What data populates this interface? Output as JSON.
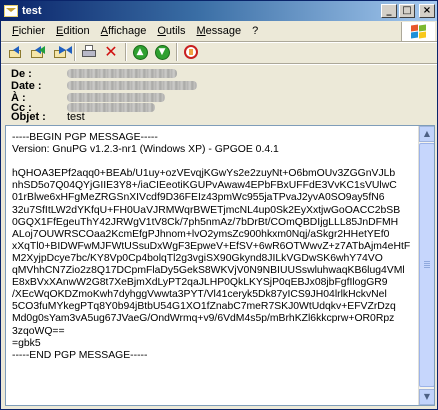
{
  "window": {
    "title": "test"
  },
  "menubar": {
    "items": [
      "Fichier",
      "Edition",
      "Affichage",
      "Outils",
      "Message",
      "?"
    ]
  },
  "toolbar": {
    "icons": [
      "reply-icon",
      "reply-all-icon",
      "forward-icon",
      "print-icon",
      "delete-icon",
      "previous-icon",
      "next-icon",
      "address-book-icon"
    ]
  },
  "headers": {
    "from_label": "De :",
    "date_label": "Date :",
    "to_label": "À :",
    "cc_label": "Cc :",
    "subject_label": "Objet :",
    "subject_value": "test"
  },
  "message": {
    "body": "-----BEGIN PGP MESSAGE-----\nVersion: GnuPG v1.2.3-nr1 (Windows XP) - GPGOE 0.4.1\n\nhQHOA3EPf2aqq0+BEAb/U1uy+ozVEvqjKGwYs2e2zuyNt+O6bmOUv3ZGGnVJLb\nnhSD5o7Q04QYjGIIE3Y8+/iaCIEeotiKGUPvAwaw4EPbFBxUFFdE3VvKC1sVUlwC\n01rBlwe6xHFgMeZRGSnXIVcdf9D36FEIz43pmWc955jaTPvaJ2yvA0SO9ay5fN6\n32u7SfItLW2dYKfqU+FH0UaVJRMWqrBWETjmcNL4up0Sk2EyXxtjwGoOACC2bSB\n0GQX1FfEgeuThY42JRWgV1tV8Ck/7ph5nmAz/7bDrBt/COmQBDIjgLLL85JnDFMH\nALoj7OUWRSCOaa2KcmEfgPJhnom+lvO2ymsZc900hkxm0Nqj/aSkgr2HHetYEf0\nxXqTl0+BIDWFwMJFWtUSsuDxWgF3EpweV+EfSV+6wR6OTWwvZ+z7ATbAjm4eHtF\nM2XyjpDcye7bc/KY8Vp0Cp4bolqTl2g3vgiSX90Gkynd8JILkVGDwSK6whY74VO\nqMVhhCN7Zio2z8Q17DCpmFlaDy5GekS8WKVjV0N9NBIUUSswluhwaqKB6lug4VMl\nE8xBVxXAnwW2G8t7XeBjmXdLyPT2qaJLHP0QkLKYSjP0qEBJx08jbFgfIlogGR9\n/XEcWqOKDZmoKwh7dyhggVwwta3PYT/Vl41ceryk5Dk87yICS9JH04lrlkHckvNel\n5CO3fuMYkegPTq8Y0b94jBtbU54G1XO1fZnabC7meR7SKJ0WtUdqkv+EFVZrDzq\nMd0g0sYam3vA5ug67JVaeG/OndWrmq+v9/6VdM4s5p/mBrhKZl6kkcprw+OR0Rpz\n3zqoWQ==\n=gbk5\n-----END PGP MESSAGE-----"
  }
}
